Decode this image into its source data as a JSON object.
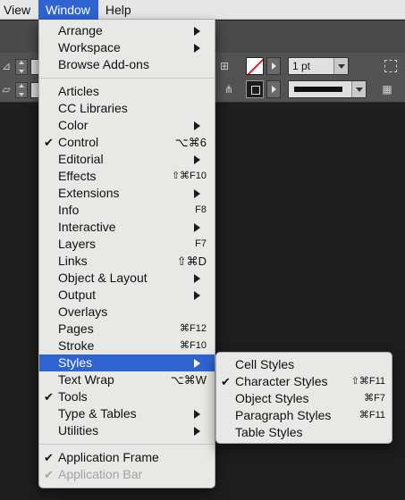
{
  "menubar": {
    "items": [
      {
        "label": "View"
      },
      {
        "label": "Window"
      },
      {
        "label": "Help"
      }
    ]
  },
  "control_panel": {
    "stroke_weight": "1 pt"
  },
  "window_menu": {
    "groups": [
      [
        {
          "label": "Arrange",
          "submenu": true
        },
        {
          "label": "Workspace",
          "submenu": true
        },
        {
          "label": "Browse Add-ons"
        }
      ],
      [
        {
          "label": "Articles"
        },
        {
          "label": "CC Libraries"
        },
        {
          "label": "Color",
          "submenu": true
        },
        {
          "label": "Control",
          "checked": true,
          "shortcut": "⌥⌘6"
        },
        {
          "label": "Editorial",
          "submenu": true
        },
        {
          "label": "Effects",
          "shortcut": "⇧⌘F10"
        },
        {
          "label": "Extensions",
          "submenu": true
        },
        {
          "label": "Info",
          "shortcut": "F8"
        },
        {
          "label": "Interactive",
          "submenu": true
        },
        {
          "label": "Layers",
          "shortcut": "F7"
        },
        {
          "label": "Links",
          "shortcut": "⇧⌘D"
        },
        {
          "label": "Object & Layout",
          "submenu": true
        },
        {
          "label": "Output",
          "submenu": true
        },
        {
          "label": "Overlays"
        },
        {
          "label": "Pages",
          "shortcut": "⌘F12"
        },
        {
          "label": "Stroke",
          "shortcut": "⌘F10"
        },
        {
          "label": "Styles",
          "submenu": true,
          "highlighted": true
        },
        {
          "label": "Text Wrap",
          "shortcut": "⌥⌘W"
        },
        {
          "label": "Tools",
          "checked": true
        },
        {
          "label": "Type & Tables",
          "submenu": true
        },
        {
          "label": "Utilities",
          "submenu": true
        }
      ],
      [
        {
          "label": "Application Frame",
          "checked": true
        },
        {
          "label": "Application Bar",
          "checked": true,
          "disabled": true
        }
      ]
    ]
  },
  "styles_submenu": {
    "items": [
      {
        "label": "Cell Styles"
      },
      {
        "label": "Character Styles",
        "checked": true,
        "shortcut": "⇧⌘F11"
      },
      {
        "label": "Object Styles",
        "shortcut": "⌘F7"
      },
      {
        "label": "Paragraph Styles",
        "shortcut": "⌘F11"
      },
      {
        "label": "Table Styles"
      }
    ]
  }
}
